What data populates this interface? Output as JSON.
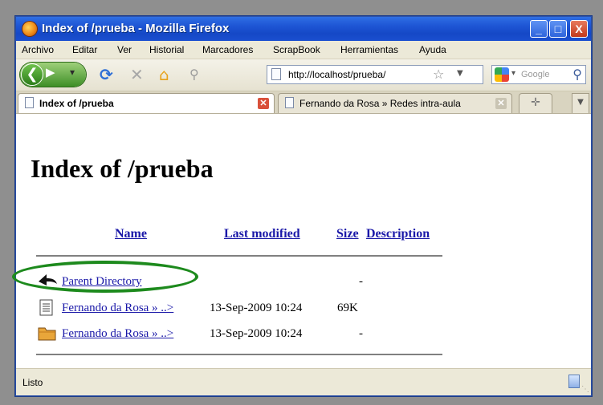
{
  "window": {
    "title": "Index of /prueba - Mozilla Firefox",
    "controls": {
      "minimize": "_",
      "maximize": "□",
      "close": "X"
    }
  },
  "menu": [
    "Archivo",
    "Editar",
    "Ver",
    "Historial",
    "Marcadores",
    "ScrapBook",
    "Herramientas",
    "Ayuda"
  ],
  "navbar": {
    "url": "http://localhost/prueba/",
    "search_placeholder": "Google"
  },
  "tabs": [
    {
      "label": "Index of /prueba",
      "active": true
    },
    {
      "label": "Fernando da Rosa » Redes intra-aula",
      "active": false
    }
  ],
  "page": {
    "heading": "Index of /prueba",
    "columns": {
      "name": "Name",
      "modified": "Last modified",
      "size": "Size",
      "description": "Description"
    },
    "rows": [
      {
        "icon": "back-arrow-icon",
        "name": "Parent Directory",
        "modified": "",
        "size": "-"
      },
      {
        "icon": "text-file-icon",
        "name": "Fernando da Rosa » ..>",
        "modified": "13-Sep-2009 10:24",
        "size": "69K"
      },
      {
        "icon": "folder-icon",
        "name": "Fernando da Rosa » ..>",
        "modified": "13-Sep-2009 10:24",
        "size": "-"
      }
    ]
  },
  "status": {
    "text": "Listo"
  },
  "colors": {
    "titlebar": "#1f57d6",
    "link": "#1a18a8",
    "annotation": "#1d8a1d"
  }
}
